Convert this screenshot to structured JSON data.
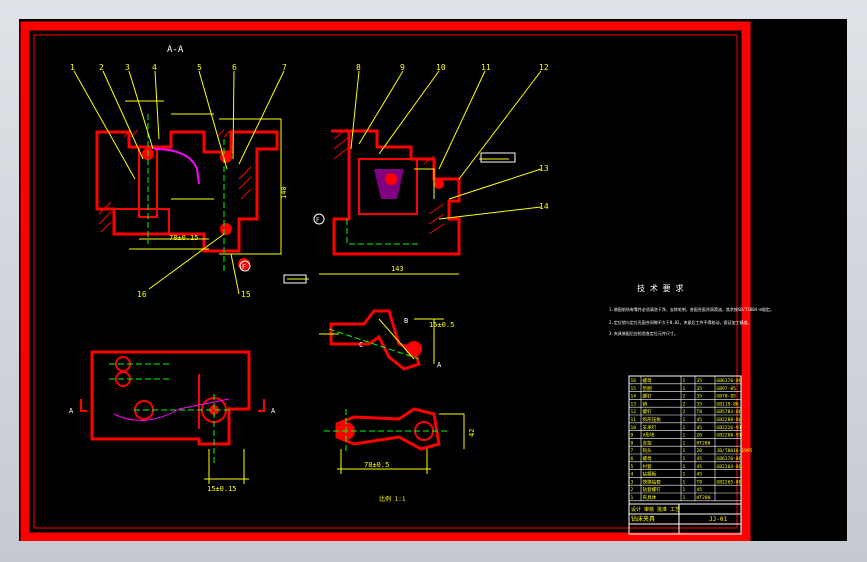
{
  "drawing": {
    "section_label": "A-A",
    "balloons_left": [
      "1",
      "2",
      "3",
      "4",
      "5",
      "6",
      "7"
    ],
    "balloons_mid": [
      "8",
      "9",
      "10",
      "11",
      "12"
    ],
    "balloon_13": "13",
    "balloon_14": "14",
    "balloon_15": "15",
    "balloon_16": "16",
    "dim_78": "78±0.15",
    "dim_143": "143",
    "dim_15": "15±0.15",
    "dim_42": "42",
    "dim_78b": "78±0.5",
    "dim_140": "140",
    "dim_15b": "15±0.5",
    "view_a_left": "A",
    "view_a_right": "A",
    "view_a_detail": "A",
    "label_b": "B",
    "label_c": "C",
    "label_f1": "F",
    "label_f2": "F",
    "tech_title": "技 术 要 求",
    "tech_lines": [
      "1.装配前所有零件必须清洗干净，去除毛刺，各配合面涂润滑油，其余按GB/T1804-m规定。",
      "2.定位销与定位孔配合间隙不大于0.02，夹紧后工件不得松动，保证加工精度。",
      "3.夹具装配后应检验各定位元件尺寸。"
    ],
    "scale_note": "比例 1:1",
    "bom_rows": [
      [
        "16",
        "螺母",
        "1",
        "35",
        "GB6170-86"
      ],
      [
        "15",
        "垫圈",
        "1",
        "35",
        "GB97-85"
      ],
      [
        "14",
        "螺钉",
        "2",
        "35",
        "GB70-85"
      ],
      [
        "13",
        "销",
        "2",
        "35",
        "GB119-86"
      ],
      [
        "12",
        "螺钉",
        "2",
        "T8",
        "GB5783-86"
      ],
      [
        "11",
        "钩形压板",
        "1",
        "45",
        "GB2288-80"
      ],
      [
        "10",
        "支承钉",
        "1",
        "45",
        "GB2226-91"
      ],
      [
        "9",
        "V形块",
        "1",
        "20",
        "GB2208-91"
      ],
      [
        "8",
        "支架",
        "1",
        "HT200",
        ""
      ],
      [
        "7",
        "钩头",
        "1",
        "20",
        "JB/T8016-1995"
      ],
      [
        "6",
        "螺母",
        "1",
        "45",
        "GB6170-86"
      ],
      [
        "5",
        "衬套",
        "1",
        "45",
        "GB2264-80"
      ],
      [
        "4",
        "钻模板",
        "1",
        "45",
        ""
      ],
      [
        "3",
        "快换钻套",
        "1",
        "T8",
        "GB2265-80"
      ],
      [
        "2",
        "钻套螺钉",
        "1",
        "45",
        ""
      ],
      [
        "1",
        "夹具体",
        "1",
        "HT200",
        ""
      ]
    ],
    "title_block": "设计 审核 批准 工艺",
    "title_name": "钻床夹具",
    "title_code": "JJ-01"
  }
}
